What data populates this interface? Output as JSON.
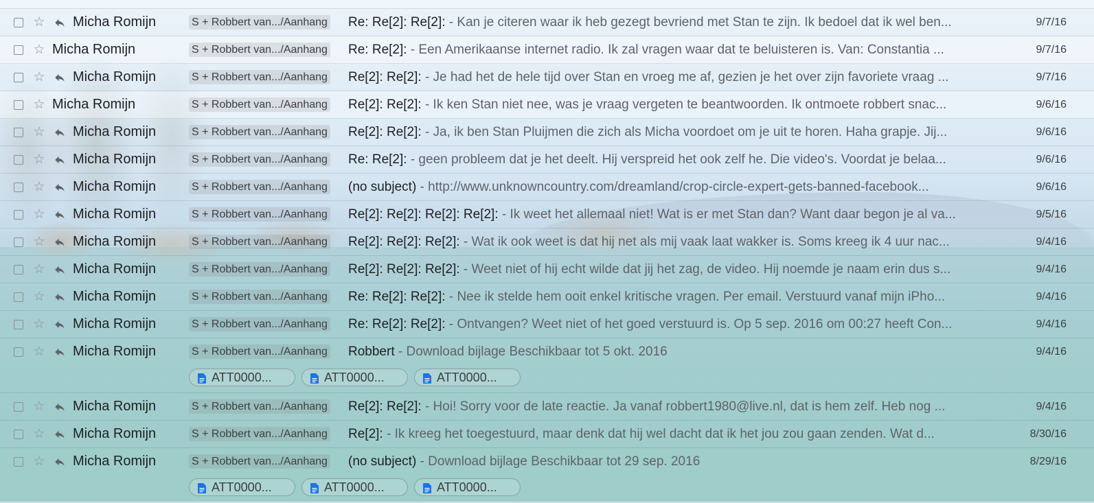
{
  "colors": {
    "doc_icon": "#1a73e8",
    "label_bg": "#e8e0de",
    "text": "#202124",
    "snippet": "#5f6368"
  },
  "icons": {
    "checkbox": "checkbox-icon",
    "star": "star-icon",
    "reply": "reply-icon",
    "attachment": "doc-icon"
  },
  "glyphs": {
    "star": "☆"
  },
  "rows": [
    {
      "sender": "Micha Romijn",
      "label": "S + Robbert van.../Aanhang",
      "subject": "Re: Re[2]: Re[2]:",
      "snippet": " - Kan je citeren waar ik heb gezegt bevriend met Stan te zijn. Ik bedoel dat ik wel ben...",
      "date": "9/7/16",
      "replied": true
    },
    {
      "sender": "Micha Romijn",
      "label": "S + Robbert van.../Aanhang",
      "subject": "Re: Re[2]:",
      "snippet": " - Een Amerikaanse internet radio. Ik zal vragen waar dat te beluisteren is. Van: Constantia ...",
      "date": "9/7/16",
      "replied": false
    },
    {
      "sender": "Micha Romijn",
      "label": "S + Robbert van.../Aanhang",
      "subject": "Re[2]: Re[2]:",
      "snippet": " - Je had het de hele tijd over Stan en vroeg me af, gezien je het over zijn favoriete vraag ...",
      "date": "9/7/16",
      "replied": true
    },
    {
      "sender": "Micha Romijn",
      "label": "S + Robbert van.../Aanhang",
      "subject": "Re[2]: Re[2]:",
      "snippet": " - Ik ken Stan niet nee, was je vraag vergeten te beantwoorden. Ik ontmoete robbert snac...",
      "date": "9/6/16",
      "replied": false
    },
    {
      "sender": "Micha Romijn",
      "label": "S + Robbert van.../Aanhang",
      "subject": "Re[2]: Re[2]:",
      "snippet": " - Ja, ik ben Stan Pluijmen die zich als Micha voordoet om je uit te horen. Haha grapje. Jij...",
      "date": "9/6/16",
      "replied": true
    },
    {
      "sender": "Micha Romijn",
      "label": "S + Robbert van.../Aanhang",
      "subject": "Re: Re[2]:",
      "snippet": " - geen probleem dat je het deelt. Hij verspreid het ook zelf he. Die video's. Voordat je belaa...",
      "date": "9/6/16",
      "replied": true
    },
    {
      "sender": "Micha Romijn",
      "label": "S + Robbert van.../Aanhang",
      "subject": "(no subject)",
      "snippet": " - http://www.unknowncountry.com/dreamland/crop-circle-expert-gets-banned-facebook...",
      "date": "9/6/16",
      "replied": true
    },
    {
      "sender": "Micha Romijn",
      "label": "S + Robbert van.../Aanhang",
      "subject": "Re[2]: Re[2]: Re[2]: Re[2]:",
      "snippet": " - Ik weet het allemaal niet! Wat is er met Stan dan? Want daar begon je al va...",
      "date": "9/5/16",
      "replied": true
    },
    {
      "sender": "Micha Romijn",
      "label": "S + Robbert van.../Aanhang",
      "subject": "Re[2]: Re[2]: Re[2]:",
      "snippet": " - Wat ik ook weet is dat hij net als mij vaak laat wakker is. Soms kreeg ik 4 uur nac...",
      "date": "9/4/16",
      "replied": true
    },
    {
      "sender": "Micha Romijn",
      "label": "S + Robbert van.../Aanhang",
      "subject": "Re[2]: Re[2]: Re[2]:",
      "snippet": " - Weet niet of hij echt wilde dat jij het zag, de video. Hij noemde je naam erin dus s...",
      "date": "9/4/16",
      "replied": true
    },
    {
      "sender": "Micha Romijn",
      "label": "S + Robbert van.../Aanhang",
      "subject": "Re: Re[2]: Re[2]:",
      "snippet": " - Nee ik stelde hem ooit enkel kritische vragen. Per email. Verstuurd vanaf mijn iPho...",
      "date": "9/4/16",
      "replied": true
    },
    {
      "sender": "Micha Romijn",
      "label": "S + Robbert van.../Aanhang",
      "subject": "Re: Re[2]: Re[2]:",
      "snippet": " - Ontvangen? Weet niet of het goed verstuurd is. Op 5 sep. 2016 om 00:27 heeft Con...",
      "date": "9/4/16",
      "replied": true
    },
    {
      "sender": "Micha Romijn",
      "label": "S + Robbert van.../Aanhang",
      "subject": "Robbert",
      "snippet": " - Download bijlage Beschikbaar tot 5 okt. 2016",
      "date": "9/4/16",
      "replied": true,
      "attachments": [
        "ATT0000...",
        "ATT0000...",
        "ATT0000..."
      ]
    },
    {
      "sender": "Micha Romijn",
      "label": "S + Robbert van.../Aanhang",
      "subject": "Re[2]: Re[2]:",
      "snippet": " - Hoi! Sorry voor de late reactie. Ja vanaf robbert1980@live.nl, dat is hem zelf. Heb nog ...",
      "date": "9/4/16",
      "replied": true
    },
    {
      "sender": "Micha Romijn",
      "label": "S + Robbert van.../Aanhang",
      "subject": "Re[2]:",
      "snippet": " - Ik kreeg het toegestuurd, maar denk dat hij wel dacht dat ik het jou zou gaan zenden. Wat d...",
      "date": "8/30/16",
      "replied": true
    },
    {
      "sender": "Micha Romijn",
      "label": "S + Robbert van.../Aanhang",
      "subject": "(no subject)",
      "snippet": " - Download bijlage Beschikbaar tot 29 sep. 2016",
      "date": "8/29/16",
      "replied": true,
      "attachments": [
        "ATT0000...",
        "ATT0000...",
        "ATT0000..."
      ]
    }
  ]
}
